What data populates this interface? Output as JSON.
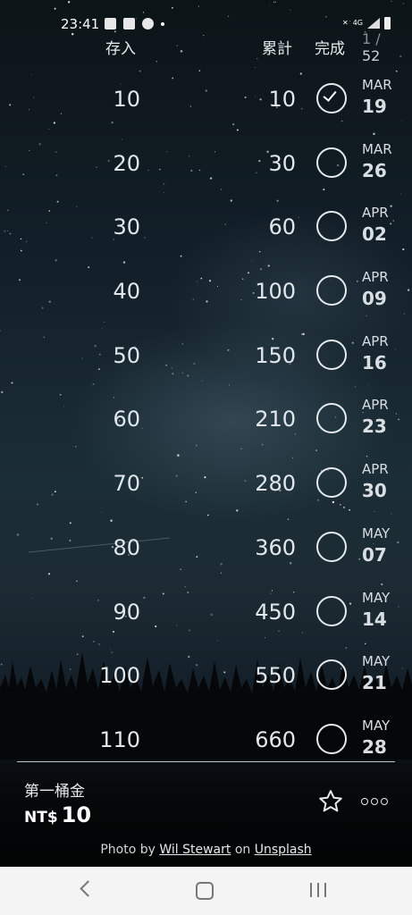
{
  "status_bar": {
    "time": "23:41",
    "network": "4G"
  },
  "header": {
    "deposit": "存入",
    "total": "累計",
    "done": "完成",
    "week_current": "1 /",
    "week_total": "52"
  },
  "rows": [
    {
      "deposit": "10",
      "total": "10",
      "done": true,
      "month": "MAR",
      "day": "19"
    },
    {
      "deposit": "20",
      "total": "30",
      "done": false,
      "month": "MAR",
      "day": "26"
    },
    {
      "deposit": "30",
      "total": "60",
      "done": false,
      "month": "APR",
      "day": "02"
    },
    {
      "deposit": "40",
      "total": "100",
      "done": false,
      "month": "APR",
      "day": "09"
    },
    {
      "deposit": "50",
      "total": "150",
      "done": false,
      "month": "APR",
      "day": "16"
    },
    {
      "deposit": "60",
      "total": "210",
      "done": false,
      "month": "APR",
      "day": "23"
    },
    {
      "deposit": "70",
      "total": "280",
      "done": false,
      "month": "APR",
      "day": "30"
    },
    {
      "deposit": "80",
      "total": "360",
      "done": false,
      "month": "MAY",
      "day": "07"
    },
    {
      "deposit": "90",
      "total": "450",
      "done": false,
      "month": "MAY",
      "day": "14"
    },
    {
      "deposit": "100",
      "total": "550",
      "done": false,
      "month": "MAY",
      "day": "21"
    },
    {
      "deposit": "110",
      "total": "660",
      "done": false,
      "month": "MAY",
      "day": "28"
    }
  ],
  "footer": {
    "goal_name": "第一桶金",
    "currency": "NT$",
    "amount": "10",
    "favorite_icon": "star-outline-icon",
    "more_icon": "more-horizontal-icon"
  },
  "credit": {
    "prefix": "Photo by",
    "author": "Wil Stewart",
    "middle": "on",
    "source": "Unsplash"
  },
  "navbar": {
    "back_icon": "back-chevron-icon",
    "home_icon": "home-icon",
    "recents_icon": "recents-icon"
  }
}
